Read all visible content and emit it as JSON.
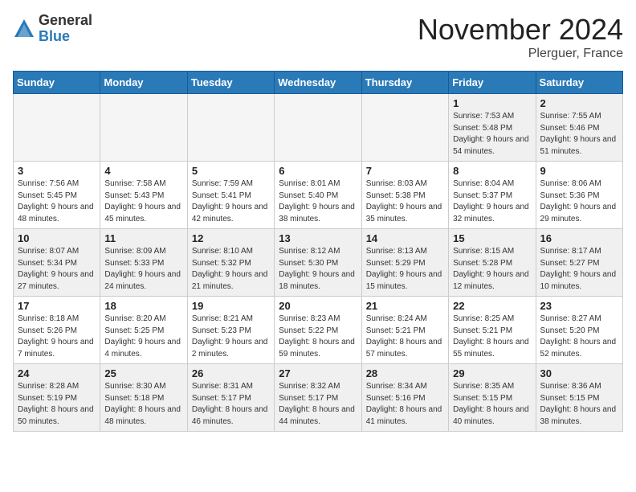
{
  "logo": {
    "general": "General",
    "blue": "Blue"
  },
  "title": "November 2024",
  "location": "Plerguer, France",
  "days_of_week": [
    "Sunday",
    "Monday",
    "Tuesday",
    "Wednesday",
    "Thursday",
    "Friday",
    "Saturday"
  ],
  "weeks": [
    [
      {
        "day": "",
        "info": "",
        "empty": true
      },
      {
        "day": "",
        "info": "",
        "empty": true
      },
      {
        "day": "",
        "info": "",
        "empty": true
      },
      {
        "day": "",
        "info": "",
        "empty": true
      },
      {
        "day": "",
        "info": "",
        "empty": true
      },
      {
        "day": "1",
        "info": "Sunrise: 7:53 AM\nSunset: 5:48 PM\nDaylight: 9 hours\nand 54 minutes."
      },
      {
        "day": "2",
        "info": "Sunrise: 7:55 AM\nSunset: 5:46 PM\nDaylight: 9 hours\nand 51 minutes."
      }
    ],
    [
      {
        "day": "3",
        "info": "Sunrise: 7:56 AM\nSunset: 5:45 PM\nDaylight: 9 hours\nand 48 minutes."
      },
      {
        "day": "4",
        "info": "Sunrise: 7:58 AM\nSunset: 5:43 PM\nDaylight: 9 hours\nand 45 minutes."
      },
      {
        "day": "5",
        "info": "Sunrise: 7:59 AM\nSunset: 5:41 PM\nDaylight: 9 hours\nand 42 minutes."
      },
      {
        "day": "6",
        "info": "Sunrise: 8:01 AM\nSunset: 5:40 PM\nDaylight: 9 hours\nand 38 minutes."
      },
      {
        "day": "7",
        "info": "Sunrise: 8:03 AM\nSunset: 5:38 PM\nDaylight: 9 hours\nand 35 minutes."
      },
      {
        "day": "8",
        "info": "Sunrise: 8:04 AM\nSunset: 5:37 PM\nDaylight: 9 hours\nand 32 minutes."
      },
      {
        "day": "9",
        "info": "Sunrise: 8:06 AM\nSunset: 5:36 PM\nDaylight: 9 hours\nand 29 minutes."
      }
    ],
    [
      {
        "day": "10",
        "info": "Sunrise: 8:07 AM\nSunset: 5:34 PM\nDaylight: 9 hours\nand 27 minutes."
      },
      {
        "day": "11",
        "info": "Sunrise: 8:09 AM\nSunset: 5:33 PM\nDaylight: 9 hours\nand 24 minutes."
      },
      {
        "day": "12",
        "info": "Sunrise: 8:10 AM\nSunset: 5:32 PM\nDaylight: 9 hours\nand 21 minutes."
      },
      {
        "day": "13",
        "info": "Sunrise: 8:12 AM\nSunset: 5:30 PM\nDaylight: 9 hours\nand 18 minutes."
      },
      {
        "day": "14",
        "info": "Sunrise: 8:13 AM\nSunset: 5:29 PM\nDaylight: 9 hours\nand 15 minutes."
      },
      {
        "day": "15",
        "info": "Sunrise: 8:15 AM\nSunset: 5:28 PM\nDaylight: 9 hours\nand 12 minutes."
      },
      {
        "day": "16",
        "info": "Sunrise: 8:17 AM\nSunset: 5:27 PM\nDaylight: 9 hours\nand 10 minutes."
      }
    ],
    [
      {
        "day": "17",
        "info": "Sunrise: 8:18 AM\nSunset: 5:26 PM\nDaylight: 9 hours\nand 7 minutes."
      },
      {
        "day": "18",
        "info": "Sunrise: 8:20 AM\nSunset: 5:25 PM\nDaylight: 9 hours\nand 4 minutes."
      },
      {
        "day": "19",
        "info": "Sunrise: 8:21 AM\nSunset: 5:23 PM\nDaylight: 9 hours\nand 2 minutes."
      },
      {
        "day": "20",
        "info": "Sunrise: 8:23 AM\nSunset: 5:22 PM\nDaylight: 8 hours\nand 59 minutes."
      },
      {
        "day": "21",
        "info": "Sunrise: 8:24 AM\nSunset: 5:21 PM\nDaylight: 8 hours\nand 57 minutes."
      },
      {
        "day": "22",
        "info": "Sunrise: 8:25 AM\nSunset: 5:21 PM\nDaylight: 8 hours\nand 55 minutes."
      },
      {
        "day": "23",
        "info": "Sunrise: 8:27 AM\nSunset: 5:20 PM\nDaylight: 8 hours\nand 52 minutes."
      }
    ],
    [
      {
        "day": "24",
        "info": "Sunrise: 8:28 AM\nSunset: 5:19 PM\nDaylight: 8 hours\nand 50 minutes."
      },
      {
        "day": "25",
        "info": "Sunrise: 8:30 AM\nSunset: 5:18 PM\nDaylight: 8 hours\nand 48 minutes."
      },
      {
        "day": "26",
        "info": "Sunrise: 8:31 AM\nSunset: 5:17 PM\nDaylight: 8 hours\nand 46 minutes."
      },
      {
        "day": "27",
        "info": "Sunrise: 8:32 AM\nSunset: 5:17 PM\nDaylight: 8 hours\nand 44 minutes."
      },
      {
        "day": "28",
        "info": "Sunrise: 8:34 AM\nSunset: 5:16 PM\nDaylight: 8 hours\nand 41 minutes."
      },
      {
        "day": "29",
        "info": "Sunrise: 8:35 AM\nSunset: 5:15 PM\nDaylight: 8 hours\nand 40 minutes."
      },
      {
        "day": "30",
        "info": "Sunrise: 8:36 AM\nSunset: 5:15 PM\nDaylight: 8 hours\nand 38 minutes."
      }
    ]
  ]
}
